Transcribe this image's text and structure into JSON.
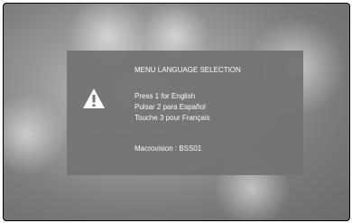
{
  "dialog": {
    "title": "MENU LANGUAGE SELECTION",
    "options": [
      "Press 1 for English",
      "Pulsar 2 para Español",
      "Touche 3 pour Français"
    ],
    "macrovision": "Macrovision : BSS01",
    "icon": "warning-icon"
  }
}
